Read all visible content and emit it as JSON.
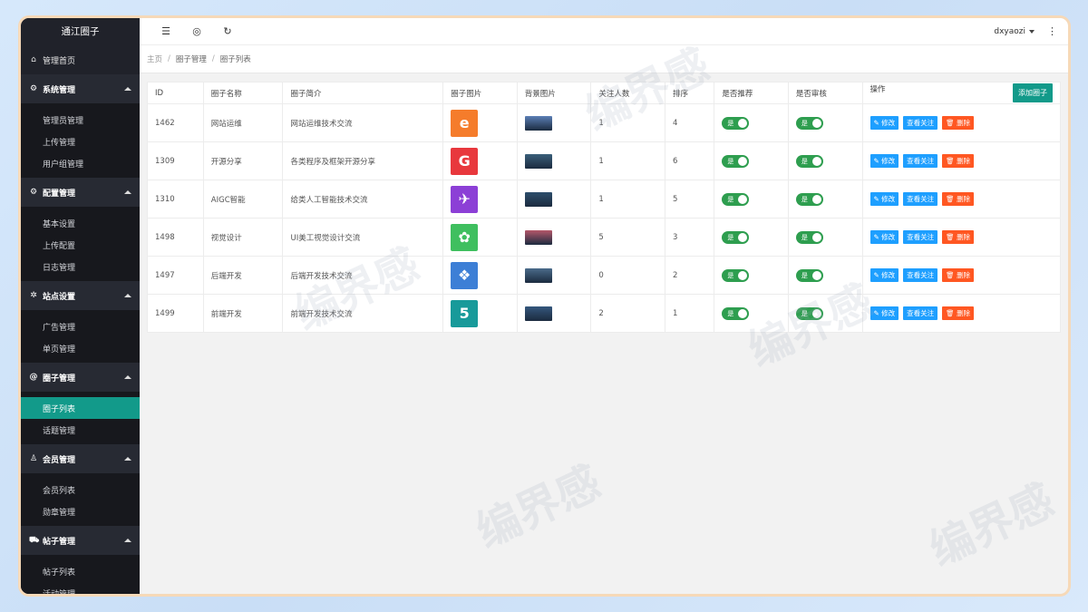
{
  "brand": "通江圈子",
  "sidebar": {
    "home": "管理首页",
    "groups": [
      {
        "label": "系统管理",
        "icon": "gear-icon",
        "items": [
          "管理员管理",
          "上传管理",
          "用户组管理"
        ]
      },
      {
        "label": "配置管理",
        "icon": "gear-icon",
        "items": [
          "基本设置",
          "上传配置",
          "日志管理"
        ]
      },
      {
        "label": "站点设置",
        "icon": "settings-icon",
        "items": [
          "广告管理",
          "单页管理"
        ]
      },
      {
        "label": "圈子管理",
        "icon": "at-icon",
        "items": [
          "圈子列表",
          "话题管理"
        ]
      },
      {
        "label": "会员管理",
        "icon": "user-icon",
        "items": [
          "会员列表",
          "勋章管理"
        ]
      },
      {
        "label": "帖子管理",
        "icon": "cart-icon",
        "items": [
          "帖子列表",
          "活动管理"
        ]
      }
    ],
    "active_item": "圈子列表"
  },
  "topbar": {
    "user": "dxyaozi"
  },
  "breadcrumb": [
    "主页",
    "圈子管理",
    "圈子列表"
  ],
  "table": {
    "headers": [
      "ID",
      "圈子名称",
      "圈子简介",
      "圈子图片",
      "背景图片",
      "关注人数",
      "排序",
      "是否推荐",
      "是否审核",
      "操作"
    ],
    "add_button": "添加圈子",
    "switch_label": "是",
    "ops": {
      "edit": "修改",
      "follows": "查看关注",
      "delete": "删除"
    },
    "rows": [
      {
        "id": "1462",
        "name": "网站运维",
        "desc": "网站运维技术交流",
        "icon_char": "e",
        "icon_color": "#f57c2b",
        "bg_color": "#5b7fb5",
        "followers": "1",
        "sort": "4"
      },
      {
        "id": "1309",
        "name": "开源分享",
        "desc": "各类程序及框架开源分享",
        "icon_char": "G",
        "icon_color": "#e8383d",
        "bg_color": "#3a5f7a",
        "followers": "1",
        "sort": "6"
      },
      {
        "id": "1310",
        "name": "AIGC智能",
        "desc": "给类人工智能技术交流",
        "icon_char": "✈",
        "icon_color": "#8c3fd6",
        "bg_color": "#2d4d6b",
        "followers": "1",
        "sort": "5"
      },
      {
        "id": "1498",
        "name": "视觉设计",
        "desc": "UI美工视觉设计交流",
        "icon_char": "✿",
        "icon_color": "#3fbf5f",
        "bg_color": "#b5576a",
        "followers": "5",
        "sort": "3"
      },
      {
        "id": "1497",
        "name": "后端开发",
        "desc": "后端开发技术交流",
        "icon_char": "❖",
        "icon_color": "#3d7fd6",
        "bg_color": "#4a6b8a",
        "followers": "0",
        "sort": "2"
      },
      {
        "id": "1499",
        "name": "前端开发",
        "desc": "前端开发技术交流",
        "icon_char": "5",
        "icon_color": "#189a9a",
        "bg_color": "#35577d",
        "followers": "2",
        "sort": "1"
      }
    ]
  },
  "watermark": "编界感"
}
